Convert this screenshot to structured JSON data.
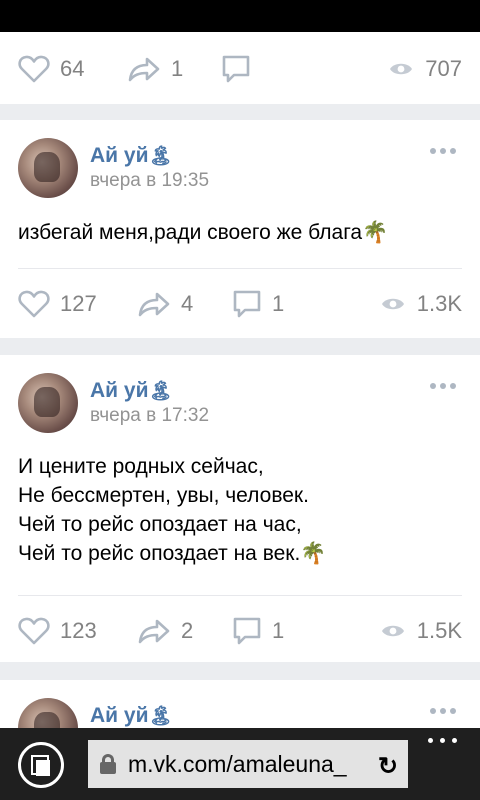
{
  "post0": {
    "likes": "64",
    "shares": "1",
    "views": "707"
  },
  "post1": {
    "author": "Ай уй",
    "author_emoji": "🏝",
    "time": "вчера в 19:35",
    "text": "избегай меня,ради своего же блага🌴",
    "likes": "127",
    "shares": "4",
    "comments": "1",
    "views": "1.3K"
  },
  "post2": {
    "author": "Ай уй",
    "author_emoji": "🏝",
    "time": "вчера в 17:32",
    "lines": [
      "И цените родных сейчас,",
      "Не бессмертен, увы, человек.",
      "Чей то рейс опоздает на час,",
      "Чей то рейс опоздает на век.🌴"
    ],
    "likes": "123",
    "shares": "2",
    "comments": "1",
    "views": "1.5K"
  },
  "post3": {
    "author": "Ай уй",
    "author_emoji": "🏝"
  },
  "browser": {
    "url": "m.vk.com/amaleuna_",
    "reload_glyph": "↻"
  },
  "icons": [
    "heart-icon",
    "share-icon",
    "comment-icon",
    "eye-icon",
    "more-icon",
    "tabs-icon",
    "lock-icon",
    "reload-icon",
    "menu-icon"
  ],
  "colors": {
    "link": "#4a76a8",
    "muted": "#828282",
    "background": "#ebedf0"
  }
}
